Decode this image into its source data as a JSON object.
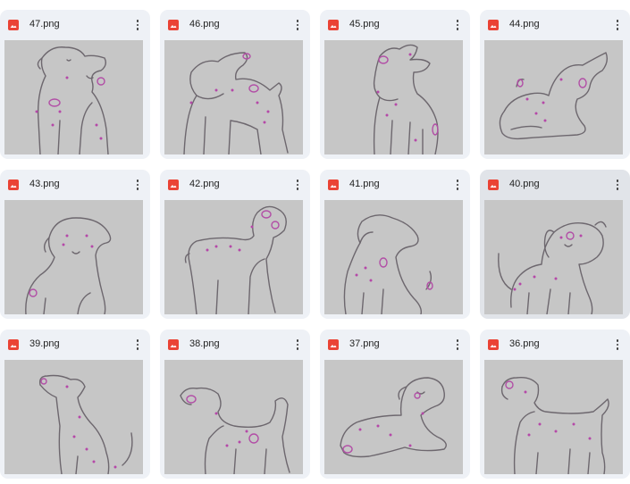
{
  "files": [
    {
      "name": "47.png",
      "icon": "image-icon",
      "dog": "sit-front-a"
    },
    {
      "name": "46.png",
      "icon": "image-icon",
      "dog": "fawn-stand"
    },
    {
      "name": "45.png",
      "icon": "image-icon",
      "dog": "sit-tall"
    },
    {
      "name": "44.png",
      "icon": "image-icon",
      "dog": "lying"
    },
    {
      "name": "43.png",
      "icon": "image-icon",
      "dog": "sit-front-b"
    },
    {
      "name": "42.png",
      "icon": "image-icon",
      "dog": "stand-right"
    },
    {
      "name": "41.png",
      "icon": "image-icon",
      "dog": "sit-left"
    },
    {
      "name": "40.png",
      "icon": "image-icon",
      "dog": "stand-big-head",
      "selected": true
    },
    {
      "name": "39.png",
      "icon": "image-icon",
      "dog": "sit-look-up"
    },
    {
      "name": "38.png",
      "icon": "image-icon",
      "dog": "stand-left-tail"
    },
    {
      "name": "37.png",
      "icon": "image-icon",
      "dog": "lying-head-up"
    },
    {
      "name": "36.png",
      "icon": "image-icon",
      "dog": "stand-left"
    }
  ],
  "colors": {
    "card_bg": "#eef1f6",
    "thumb_bg": "#c6c6c6",
    "image_icon": "#ea4335",
    "line": "#6d676e",
    "spots": "#b548a8"
  },
  "menu_icon": "more-vert-icon"
}
